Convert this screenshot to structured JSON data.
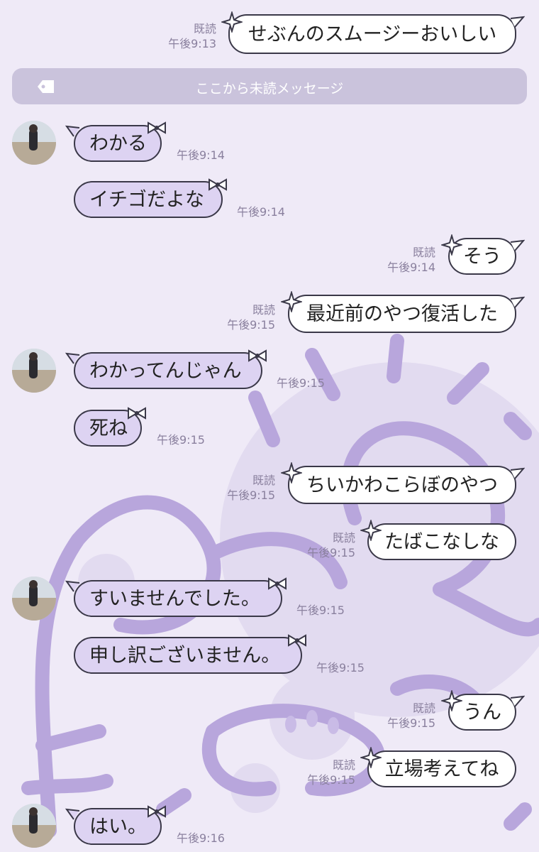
{
  "divider": {
    "label": "ここから未読メッセージ",
    "icon": "tag-icon"
  },
  "read_label": "既読",
  "colors": {
    "background": "#efeaf7",
    "received_bubble": "#ddd3f2",
    "sent_bubble": "#ffffff",
    "divider": "#cac3dc",
    "meta_text": "#8a809e"
  },
  "messages": [
    {
      "side": "sent",
      "text": "せぶんのスムージーおいしい",
      "read": "既読",
      "time": "午後9:13"
    },
    {
      "side": "received",
      "text": "わかる",
      "time": "午後9:14"
    },
    {
      "side": "received",
      "text": "イチゴだよな",
      "time": "午後9:14"
    },
    {
      "side": "sent",
      "text": "そう",
      "read": "既読",
      "time": "午後9:14"
    },
    {
      "side": "sent",
      "text": "最近前のやつ復活した",
      "read": "既読",
      "time": "午後9:15"
    },
    {
      "side": "received",
      "text": "わかってんじゃん",
      "time": "午後9:15"
    },
    {
      "side": "received",
      "text": "死ね",
      "time": "午後9:15"
    },
    {
      "side": "sent",
      "text": "ちいかわこらぼのやつ",
      "read": "既読",
      "time": "午後9:15"
    },
    {
      "side": "sent",
      "text": "たばこなしな",
      "read": "既読",
      "time": "午後9:15"
    },
    {
      "side": "received",
      "text": "すいませんでした。",
      "time": "午後9:15"
    },
    {
      "side": "received",
      "text": "申し訳ございません。",
      "time": "午後9:15"
    },
    {
      "side": "sent",
      "text": "うん",
      "read": "既読",
      "time": "午後9:15"
    },
    {
      "side": "sent",
      "text": "立場考えてね",
      "read": "既読",
      "time": "午後9:15"
    },
    {
      "side": "received",
      "text": "はい。",
      "time": "午後9:16"
    }
  ]
}
